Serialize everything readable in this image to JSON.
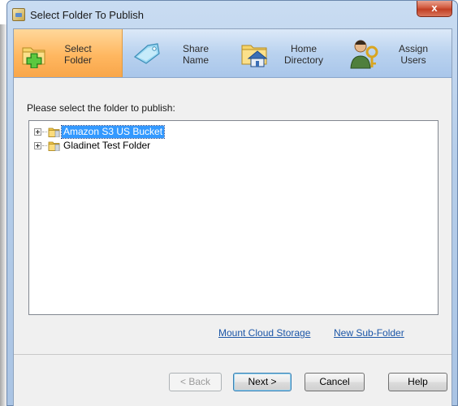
{
  "window": {
    "title": "Select Folder To Publish",
    "close_glyph": "x"
  },
  "steps": [
    {
      "line1": "Select",
      "line2": "Folder",
      "icon": "folder-add-icon",
      "active": true
    },
    {
      "line1": "Share",
      "line2": "Name",
      "icon": "tag-icon",
      "active": false
    },
    {
      "line1": "Home",
      "line2": "Directory",
      "icon": "home-folder-icon",
      "active": false
    },
    {
      "line1": "Assign",
      "line2": "Users",
      "icon": "users-key-icon",
      "active": false
    }
  ],
  "prompt": "Please select the folder to publish:",
  "tree": {
    "items": [
      {
        "label": "Amazon S3 US Bucket",
        "selected": true
      },
      {
        "label": "Gladinet Test Folder",
        "selected": false
      }
    ]
  },
  "links": {
    "mount": "Mount Cloud Storage",
    "new_sub": "New Sub-Folder"
  },
  "buttons": {
    "back": "< Back",
    "next": "Next >",
    "cancel": "Cancel",
    "help": "Help"
  },
  "colors": {
    "active_step": "#ffb760",
    "step_bar": "#b9d2ef",
    "selection": "#3399ff",
    "link": "#1c56a7"
  }
}
